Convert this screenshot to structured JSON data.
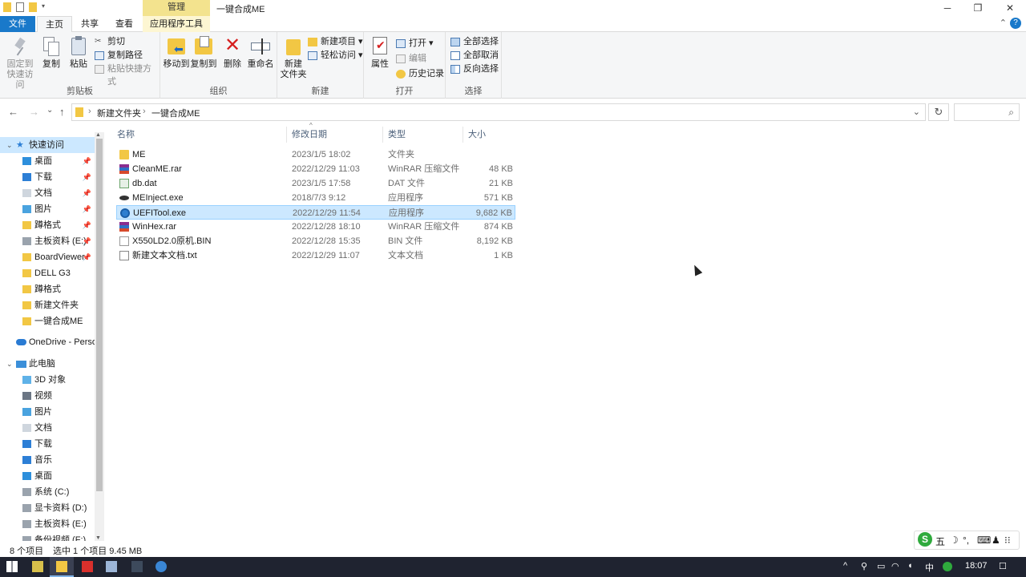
{
  "window": {
    "title": "一键合成ME",
    "context_tab_group": "管理",
    "minimize_glyph": "─",
    "maximize_glyph": "❐",
    "close_glyph": "✕"
  },
  "ribbon_tabs": {
    "file": "文件",
    "home": "主页",
    "share": "共享",
    "view": "查看",
    "app_tools": "应用程序工具",
    "collapse_glyph": "⌃",
    "help_glyph": "?"
  },
  "ribbon": {
    "clipboard": {
      "label": "剪贴板",
      "pin_quick": "固定到\n快速访问",
      "copy": "复制",
      "paste": "粘贴",
      "cut": "剪切",
      "copy_path": "复制路径",
      "paste_shortcut": "粘贴快捷方式"
    },
    "organize": {
      "label": "组织",
      "move_to": "移动到",
      "copy_to": "复制到",
      "delete": "删除",
      "rename": "重命名"
    },
    "new": {
      "label": "新建",
      "new_folder": "新建\n文件夹",
      "new_item": "新建项目 ▾",
      "easy_access": "轻松访问 ▾"
    },
    "open": {
      "label": "打开",
      "properties": "属性",
      "open": "打开 ▾",
      "edit": "编辑",
      "history": "历史记录"
    },
    "select": {
      "label": "选择",
      "select_all": "全部选择",
      "select_none": "全部取消",
      "invert": "反向选择"
    }
  },
  "address": {
    "back_glyph": "←",
    "forward_glyph": "→",
    "recent_glyph": "⌄",
    "up_glyph": "↑",
    "crumbs": [
      "新建文件夹",
      "一键合成ME"
    ],
    "separator": "›",
    "dropdown_glyph": "⌄",
    "refresh_glyph": "↻",
    "search_glyph": "⌕"
  },
  "nav_pane": {
    "quick_access": "快速访问",
    "items": [
      {
        "label": "桌面",
        "icon": "desktop-icon",
        "pinned": true
      },
      {
        "label": "下载",
        "icon": "download-icon",
        "pinned": true
      },
      {
        "label": "文档",
        "icon": "document-icon",
        "pinned": true
      },
      {
        "label": "图片",
        "icon": "picture-icon",
        "pinned": true
      },
      {
        "label": "蹲格式",
        "icon": "folder-icon",
        "pinned": true
      },
      {
        "label": "主板资料 (E:)",
        "icon": "drive-icon",
        "pinned": true
      },
      {
        "label": "BoardViewer",
        "icon": "folder-icon",
        "pinned": true
      },
      {
        "label": "DELL G3",
        "icon": "folder-icon",
        "pinned": false
      },
      {
        "label": "蹲格式",
        "icon": "folder-icon",
        "pinned": false
      },
      {
        "label": "新建文件夹",
        "icon": "folder-icon",
        "pinned": false
      },
      {
        "label": "一键合成ME",
        "icon": "folder-icon",
        "pinned": false
      }
    ],
    "onedrive": "OneDrive - Perso",
    "this_pc": "此电脑",
    "pc_items": [
      {
        "label": "3D 对象",
        "icon": "3d-objects-icon"
      },
      {
        "label": "视频",
        "icon": "video-icon"
      },
      {
        "label": "图片",
        "icon": "picture-icon"
      },
      {
        "label": "文档",
        "icon": "document-icon"
      },
      {
        "label": "下载",
        "icon": "download-icon"
      },
      {
        "label": "音乐",
        "icon": "music-icon"
      },
      {
        "label": "桌面",
        "icon": "desktop-icon"
      },
      {
        "label": "系统 (C:)",
        "icon": "drive-icon"
      },
      {
        "label": "显卡资料 (D:)",
        "icon": "drive-icon"
      },
      {
        "label": "主板资料 (E:)",
        "icon": "drive-icon"
      },
      {
        "label": "备份视频 (F:)",
        "icon": "drive-icon"
      }
    ],
    "pin_glyph": "📌",
    "scroll_up_glyph": "▲",
    "scroll_down_glyph": "▼"
  },
  "file_list": {
    "columns": [
      "名称",
      "修改日期",
      "类型",
      "大小"
    ],
    "sort_glyph": "^",
    "rows": [
      {
        "name": "ME",
        "date": "2023/1/5 18:02",
        "type": "文件夹",
        "size": "",
        "icon": "folder-icon",
        "selected": false
      },
      {
        "name": "CleanME.rar",
        "date": "2022/12/29 11:03",
        "type": "WinRAR 压缩文件",
        "size": "48 KB",
        "icon": "winrar-icon",
        "selected": false
      },
      {
        "name": "db.dat",
        "date": "2023/1/5 17:58",
        "type": "DAT 文件",
        "size": "21 KB",
        "icon": "dat-file-icon",
        "selected": false
      },
      {
        "name": "MEInject.exe",
        "date": "2018/7/3 9:12",
        "type": "应用程序",
        "size": "571 KB",
        "icon": "app-icon",
        "selected": false
      },
      {
        "name": "UEFITool.exe",
        "date": "2022/12/29 11:54",
        "type": "应用程序",
        "size": "9,682 KB",
        "icon": "gear-app-icon",
        "selected": true
      },
      {
        "name": "WinHex.rar",
        "date": "2022/12/28 18:10",
        "type": "WinRAR 压缩文件",
        "size": "874 KB",
        "icon": "winrar-icon",
        "selected": false
      },
      {
        "name": "X550LD2.0原机.BIN",
        "date": "2022/12/28 15:35",
        "type": "BIN 文件",
        "size": "8,192 KB",
        "icon": "blank-file-icon",
        "selected": false
      },
      {
        "name": "新建文本文档.txt",
        "date": "2022/12/29 11:07",
        "type": "文本文档",
        "size": "1 KB",
        "icon": "text-file-icon",
        "selected": false
      }
    ]
  },
  "status_bar": {
    "count": "8 个项目",
    "selection": "选中 1 个项目  9.45 MB"
  },
  "ime": {
    "logo": "S",
    "mode": "五",
    "moon": "☽",
    "punct": "°,",
    "keyboard": "⌨",
    "user": "♟",
    "grid": "⁝⁝"
  },
  "taskbar": {
    "tray_up": "^",
    "clock": "18:07",
    "lang": "中",
    "notify_glyph": "☐"
  },
  "colors": {
    "accent": "#1979ca",
    "selection": "#cce8ff",
    "context_tab": "#f3e38e",
    "taskbar": "#1f2330"
  }
}
